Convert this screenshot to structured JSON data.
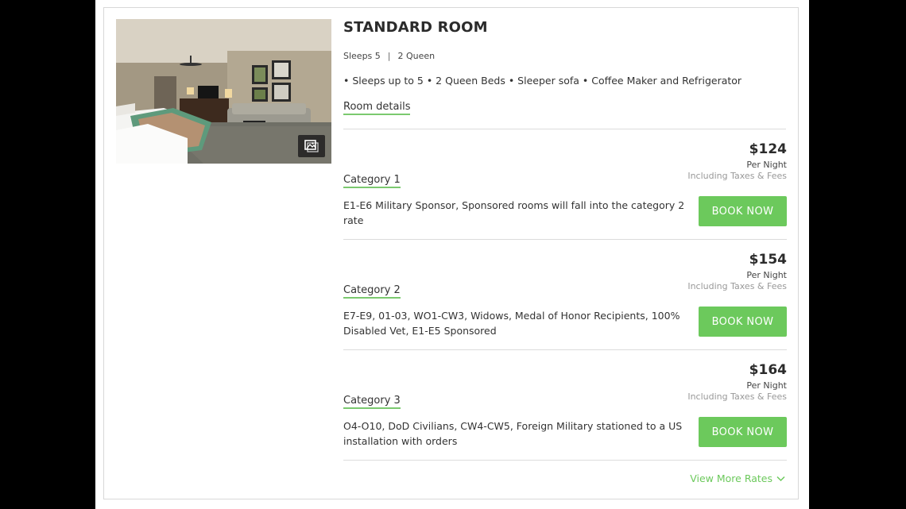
{
  "room": {
    "title": "STANDARD ROOM",
    "sleeps": "Sleeps 5",
    "separator": "|",
    "beds": "2 Queen",
    "amenities": "• Sleeps up to 5 • 2 Queen Beds • Sleeper sofa • Coffee Maker and Refrigerator",
    "details_link": "Room details",
    "gallery_icon": "image-gallery-icon"
  },
  "rates": [
    {
      "category": "Category 1",
      "price": "$124",
      "per_night": "Per Night",
      "taxes": "Including Taxes & Fees",
      "description": "E1-E6 Military Sponsor, Sponsored rooms will fall into the category 2 rate",
      "button": "BOOK NOW"
    },
    {
      "category": "Category 2",
      "price": "$154",
      "per_night": "Per Night",
      "taxes": "Including Taxes & Fees",
      "description": "E7-E9, 01-03, WO1-CW3, Widows, Medal of Honor Recipients, 100% Disabled Vet, E1-E5 Sponsored",
      "button": "BOOK NOW"
    },
    {
      "category": "Category 3",
      "price": "$164",
      "per_night": "Per Night",
      "taxes": "Including Taxes & Fees",
      "description": "O4-O10, DoD Civilians, CW4-CW5, Foreign Military stationed to a US installation with orders",
      "button": "BOOK NOW"
    }
  ],
  "view_more": "View More Rates",
  "colors": {
    "accent": "#6cc95c",
    "text": "#333333",
    "muted": "#999999",
    "divider": "#dcdcdc",
    "backdrop": "#000000"
  }
}
